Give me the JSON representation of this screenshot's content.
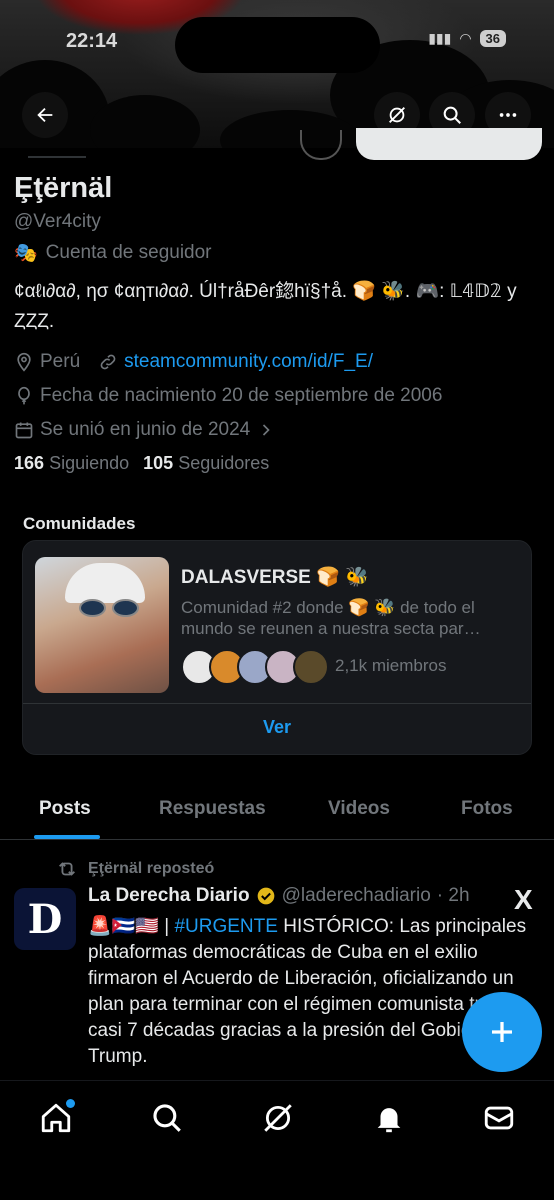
{
  "status_bar": {
    "time": "22:14",
    "battery": "36"
  },
  "profile": {
    "display_name": "Ȩţërnäl",
    "handle": "@Ver4city",
    "account_type": "Cuenta de seguidor",
    "bio": "¢αℓι∂α∂, ησ ¢αηтι∂α∂. Úl†råĐêr鍃hï§†å. 🍞 🐝. 🎮: 𝕃𝟜𝔻𝟚 y ȤȤȤ.",
    "location": "Perú",
    "website": "steamcommunity.com/id/F_E/",
    "birthday": "Fecha de nacimiento 20 de septiembre de 2006",
    "joined": "Se unió en junio de 2024",
    "following_count": "166",
    "following_label": "Siguiendo",
    "followers_count": "105",
    "followers_label": "Seguidores"
  },
  "communities": {
    "title": "Comunidades",
    "name": "DALASVERSE 🍞 🐝",
    "description": "Comunidad #2 donde 🍞 🐝 de todo el mundo se reunen a nuestra secta par…",
    "members": "2,1k miembros",
    "see_label": "Ver"
  },
  "tabs": [
    {
      "label": "Posts"
    },
    {
      "label": "Respuestas"
    },
    {
      "label": "Videos"
    },
    {
      "label": "Fotos"
    }
  ],
  "post": {
    "repost_label": "Ȩţërnäl reposteó",
    "author_name": "La Derecha Diario",
    "author_handle": "@laderechadiario",
    "time": "· 2h",
    "avatar_letter": "D",
    "x_label": "X",
    "text_prefix": "🚨🇨🇺🇺🇸 | ",
    "hashtag": "#URGENTE",
    "text_body": " HISTÓRICO: Las principales plataformas democráticas de Cuba en el exilio firmaron el Acuerdo de Liberación, oficializando un plan para terminar con el régimen comunista tras casi 7 décadas gracias a la presión del Gobierno de Trump."
  },
  "colors": {
    "accent": "#1d9bf0",
    "background": "#000000",
    "muted": "#71767b"
  }
}
